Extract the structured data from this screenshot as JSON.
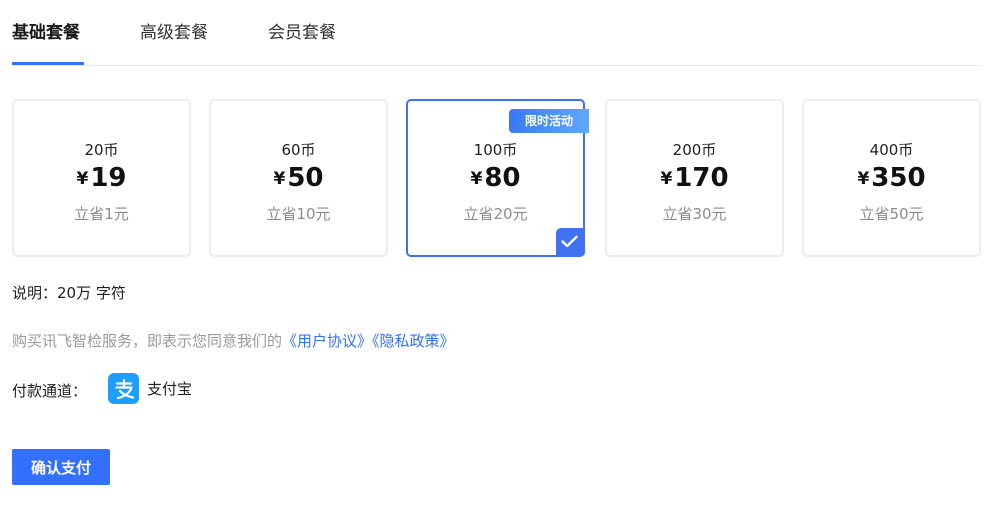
{
  "tabs": [
    {
      "label": "基础套餐",
      "active": true
    },
    {
      "label": "高级套餐",
      "active": false
    },
    {
      "label": "会员套餐",
      "active": false
    }
  ],
  "packages": [
    {
      "coins": "20币",
      "currency": "¥",
      "price": "19",
      "saving": "立省1元",
      "selected": false
    },
    {
      "coins": "60币",
      "currency": "¥",
      "price": "50",
      "saving": "立省10元",
      "selected": false
    },
    {
      "coins": "100币",
      "currency": "¥",
      "price": "80",
      "saving": "立省20元",
      "selected": true,
      "badge": "限时活动"
    },
    {
      "coins": "200币",
      "currency": "¥",
      "price": "170",
      "saving": "立省30元",
      "selected": false
    },
    {
      "coins": "400币",
      "currency": "¥",
      "price": "350",
      "saving": "立省50元",
      "selected": false
    }
  ],
  "note": "说明：20万 字符",
  "agreement": {
    "prefix": "购买讯飞智检服务，即表示您同意我们的",
    "user_agreement": "《用户协议》",
    "privacy_policy": "《隐私政策》"
  },
  "payment": {
    "label": "付款通道：",
    "method": "支付宝",
    "icon": "alipay-icon"
  },
  "confirm_label": "确认支付",
  "colors": {
    "accent": "#3370ff",
    "selected_border": "#3f71f0",
    "muted_text": "#8c8c8c",
    "alipay_blue": "#1a9fff"
  }
}
